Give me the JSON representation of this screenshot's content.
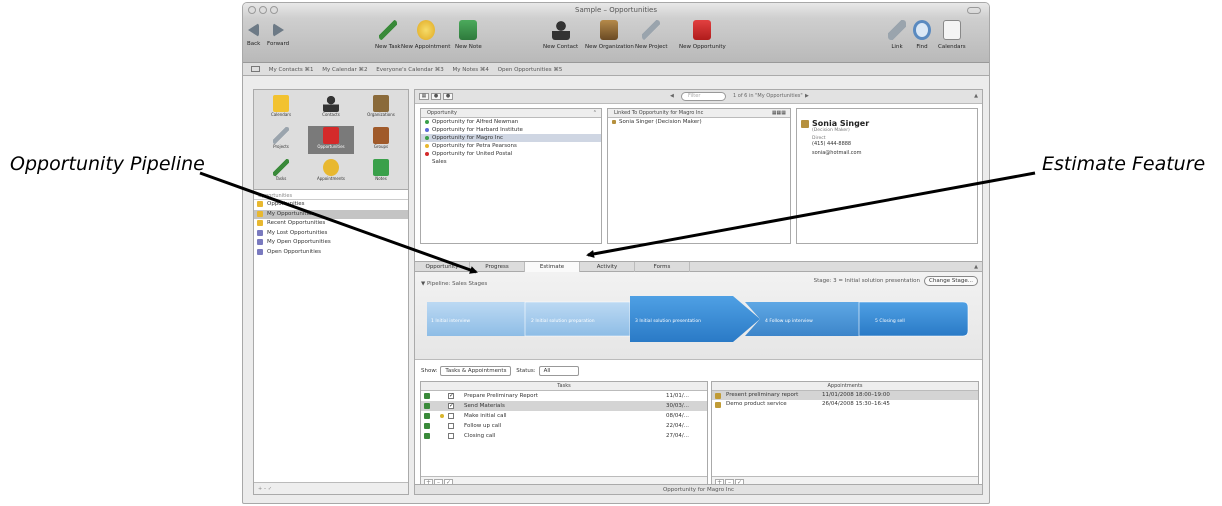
{
  "callouts": {
    "left": "Opportunity Pipeline",
    "right": "Estimate Feature"
  },
  "window": {
    "title": "Sample – Opportunities"
  },
  "toolbar": {
    "items": [
      {
        "label": "Back",
        "icon": "back-arrow-icon"
      },
      {
        "label": "Forward",
        "icon": "forward-arrow-icon"
      },
      {
        "label": "New Task",
        "icon": "pin-icon"
      },
      {
        "label": "New Appointment",
        "icon": "smiley-icon"
      },
      {
        "label": "New Note",
        "icon": "note-icon"
      },
      {
        "label": "New Contact",
        "icon": "person-icon"
      },
      {
        "label": "New Organization",
        "icon": "building-icon"
      },
      {
        "label": "New Project",
        "icon": "wrench-icon"
      },
      {
        "label": "New Opportunity",
        "icon": "red-book-icon"
      },
      {
        "label": "Link",
        "icon": "link-icon"
      },
      {
        "label": "Find",
        "icon": "magnifier-icon"
      },
      {
        "label": "Calendars",
        "icon": "calendar-icon"
      }
    ]
  },
  "favorites": [
    "My Contacts ⌘1",
    "My Calendar ⌘2",
    "Everyone's Calendar ⌘3",
    "My Notes ⌘4",
    "Open Opportunities ⌘5"
  ],
  "sidebar": {
    "grid": [
      {
        "label": "Calendars",
        "icon": "calendar-icon",
        "color": "#f2c230"
      },
      {
        "label": "Contacts",
        "icon": "person-icon",
        "color": "#3a3a3a"
      },
      {
        "label": "Organizations",
        "icon": "building-icon",
        "color": "#8a6a3a"
      },
      {
        "label": "Projects",
        "icon": "wrench-icon",
        "color": "#9aa4ad"
      },
      {
        "label": "Opportunities",
        "icon": "red-book-icon",
        "color": "#d42a2a"
      },
      {
        "label": "Groups",
        "icon": "group-icon",
        "color": "#a05a2a"
      },
      {
        "label": "Tasks",
        "icon": "pin-icon",
        "color": "#3a8a3a"
      },
      {
        "label": "Appointments",
        "icon": "smiley-icon",
        "color": "#e8b830"
      },
      {
        "label": "Notes",
        "icon": "note-icon",
        "color": "#3aa04a"
      }
    ],
    "section_header": "Opportunities",
    "items": [
      {
        "label": "Opportunities",
        "color": "#e8b830"
      },
      {
        "label": "My Opportunities",
        "color": "#e8b830"
      },
      {
        "label": "Recent Opportunities",
        "color": "#e8b830"
      },
      {
        "label": "My Lost Opportunities",
        "color": "#7a7abf"
      },
      {
        "label": "My Open Opportunities",
        "color": "#7a7abf"
      },
      {
        "label": "Open Opportunities",
        "color": "#7a7abf"
      }
    ],
    "footer": "+  –  ✓"
  },
  "main": {
    "nav_label": "1 of 6 in \"My Opportunities\"",
    "search_placeholder": "Filter",
    "opp_column": "Opportunity",
    "opportunities": [
      {
        "label": "Opportunity for Alfred Newman",
        "color": "#3aa04a"
      },
      {
        "label": "Opportunity for Harbard Institute",
        "color": "#5a6ad8"
      },
      {
        "label": "Opportunity for Magro Inc",
        "color": "#3aa04a"
      },
      {
        "label": "Opportunity for Petra Pearsons",
        "color": "#e8b830"
      },
      {
        "label": "Opportunity for United Postal",
        "color": "#d42a2a"
      },
      {
        "label": "Sales",
        "color": ""
      }
    ],
    "linked_header": "Linked To Opportunity for Magro Inc",
    "linked_item": "Sonia Singer (Decision Maker)",
    "contact": {
      "name": "Sonia Singer",
      "role": "(Decision Maker)",
      "type": "Direct",
      "phone": "(415) 444-8888",
      "email": "sonia@hotmail.com"
    },
    "tabs": [
      "Opportunity",
      "Progress",
      "Estimate",
      "Activity",
      "Forms"
    ],
    "pipeline_label": "▼ Pipeline: Sales Stages",
    "stage_text": "Stage: 3 = Initial solution presentation",
    "change_stage": "Change Stage...",
    "stages": [
      {
        "num": "1",
        "label": "Initial interview"
      },
      {
        "num": "2",
        "label": "Initial solution preparation"
      },
      {
        "num": "3",
        "label": "Initial solution presentation"
      },
      {
        "num": "4",
        "label": "Follow up interview"
      },
      {
        "num": "5",
        "label": "Closing sell"
      }
    ],
    "show_label": "Show:",
    "show_value": "Tasks & Appointments",
    "status_label": "Status:",
    "status_value": "All",
    "tasks_header": "Tasks",
    "tasks": [
      {
        "name": "Prepare Preliminary Report",
        "date": "11/01/...",
        "checked": true
      },
      {
        "name": "Send Materials",
        "date": "30/03/...",
        "checked": true
      },
      {
        "name": "Make initial call",
        "date": "08/04/...",
        "checked": false
      },
      {
        "name": "Follow up call",
        "date": "22/04/...",
        "checked": false
      },
      {
        "name": "Closing call",
        "date": "27/04/...",
        "checked": false
      }
    ],
    "appointments_header": "Appointments",
    "appointments": [
      {
        "name": "Present preliminary report",
        "date": "11/01/2008 18:00–19:00"
      },
      {
        "name": "Demo product service",
        "date": "26/04/2008 15:30–16:45"
      }
    ],
    "status_bar": "Opportunity for Magro Inc"
  },
  "colors": {
    "pipeline_blue": "#3d8fd6",
    "pipeline_light": "#a9cdef",
    "selection": "#cfd6e3"
  }
}
